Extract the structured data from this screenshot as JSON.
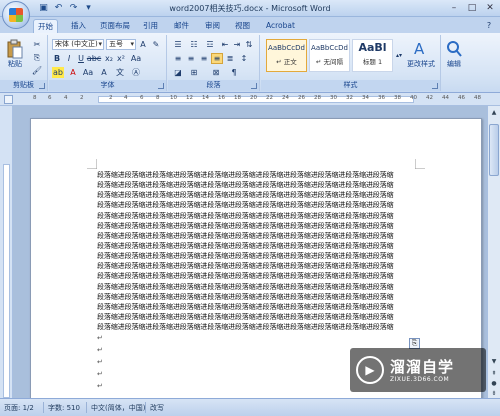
{
  "window": {
    "title": "word2007相关技巧.docx - Microsoft Word"
  },
  "tabs": [
    {
      "label": "开始"
    },
    {
      "label": "插入"
    },
    {
      "label": "页面布局"
    },
    {
      "label": "引用"
    },
    {
      "label": "邮件"
    },
    {
      "label": "审阅"
    },
    {
      "label": "视图"
    },
    {
      "label": "Acrobat"
    }
  ],
  "ribbon": {
    "clipboard": {
      "paste_label": "粘贴",
      "group_label": "剪贴板"
    },
    "font": {
      "font_name": "宋体 (中文正)",
      "font_size": "五号",
      "group_label": "字体"
    },
    "paragraph": {
      "group_label": "段落"
    },
    "styles": {
      "items": [
        {
          "sample": "AaBbCcDd",
          "name": "↵ 正文"
        },
        {
          "sample": "AaBbCcDd",
          "name": "↵ 无间隔"
        },
        {
          "sample": "AaBl",
          "name": "标题 1"
        }
      ],
      "change_label": "更改样式",
      "group_label": "样式"
    },
    "editing": {
      "label": "编辑"
    }
  },
  "ruler": {
    "numbers": [
      "8",
      "6",
      "4",
      "2",
      "2",
      "4",
      "6",
      "8",
      "10",
      "12",
      "14",
      "16",
      "18",
      "20",
      "22",
      "24",
      "26",
      "28",
      "30",
      "32",
      "34",
      "36",
      "38",
      "40",
      "42",
      "44",
      "46",
      "48"
    ]
  },
  "document": {
    "lines": [
      "段落缩进段落缩进段落缩进段落缩进段落缩进段落缩进段落缩进段落缩进段落缩进段落缩进段落缩",
      "段落缩进段落缩进段落缩进段落缩进段落缩进段落缩进段落缩进段落缩进段落缩进段落缩进段落缩",
      "段落缩进段落缩进段落缩进段落缩进段落缩进段落缩进段落缩进段落缩进段落缩进段落缩进段落缩",
      "段落缩进段落缩进段落缩进段落缩进段落缩进段落缩进段落缩进段落缩进段落缩进段落缩进段落缩",
      "段落缩进段落缩进段落缩进段落缩进段落缩进段落缩进段落缩进段落缩进段落缩进段落缩进段落缩",
      "段落缩进段落缩进段落缩进段落缩进段落缩进段落缩进段落缩进段落缩进段落缩进段落缩进段落缩",
      "段落缩进段落缩进段落缩进段落缩进段落缩进段落缩进段落缩进段落缩进段落缩进段落缩进段落缩",
      "段落缩进段落缩进段落缩进段落缩进段落缩进段落缩进段落缩进段落缩进段落缩进段落缩进段落缩",
      "段落缩进段落缩进段落缩进段落缩进段落缩进段落缩进段落缩进段落缩进段落缩进段落缩进段落缩",
      "段落缩进段落缩进段落缩进段落缩进段落缩进段落缩进段落缩进段落缩进段落缩进段落缩进段落缩",
      "段落缩进段落缩进段落缩进段落缩进段落缩进段落缩进段落缩进段落缩进段落缩进段落缩进段落缩",
      "段落缩进段落缩进段落缩进段落缩进段落缩进段落缩进段落缩进段落缩进段落缩进段落缩进段落缩",
      "段落缩进段落缩进段落缩进段落缩进段落缩进段落缩进段落缩进段落缩进段落缩进段落缩进段落缩",
      "段落缩进段落缩进段落缩进段落缩进段落缩进段落缩进段落缩进段落缩进段落缩进段落缩进段落缩",
      "段落缩进段落缩进段落缩进段落缩进段落缩进段落缩进段落缩进段落缩进段落缩进段落缩进段落缩",
      "段落缩进段落缩进段落缩进段落缩进段落缩进段落缩进段落缩进段落缩进段落缩进段落缩进段落缩"
    ],
    "paragraph_mark": "↵"
  },
  "watermark": {
    "title": "溜溜自学",
    "subtitle": "ZIXUE.3D66.COM"
  },
  "statusbar": {
    "page": "页面: 1/2",
    "words": "字数: 510",
    "language": "中文(简体，中国)",
    "mode": "改写"
  },
  "colors": {
    "ribbon_bg": "#d6e4f5",
    "workspace_bg": "#a9bfdc",
    "accent": "#15428b"
  }
}
